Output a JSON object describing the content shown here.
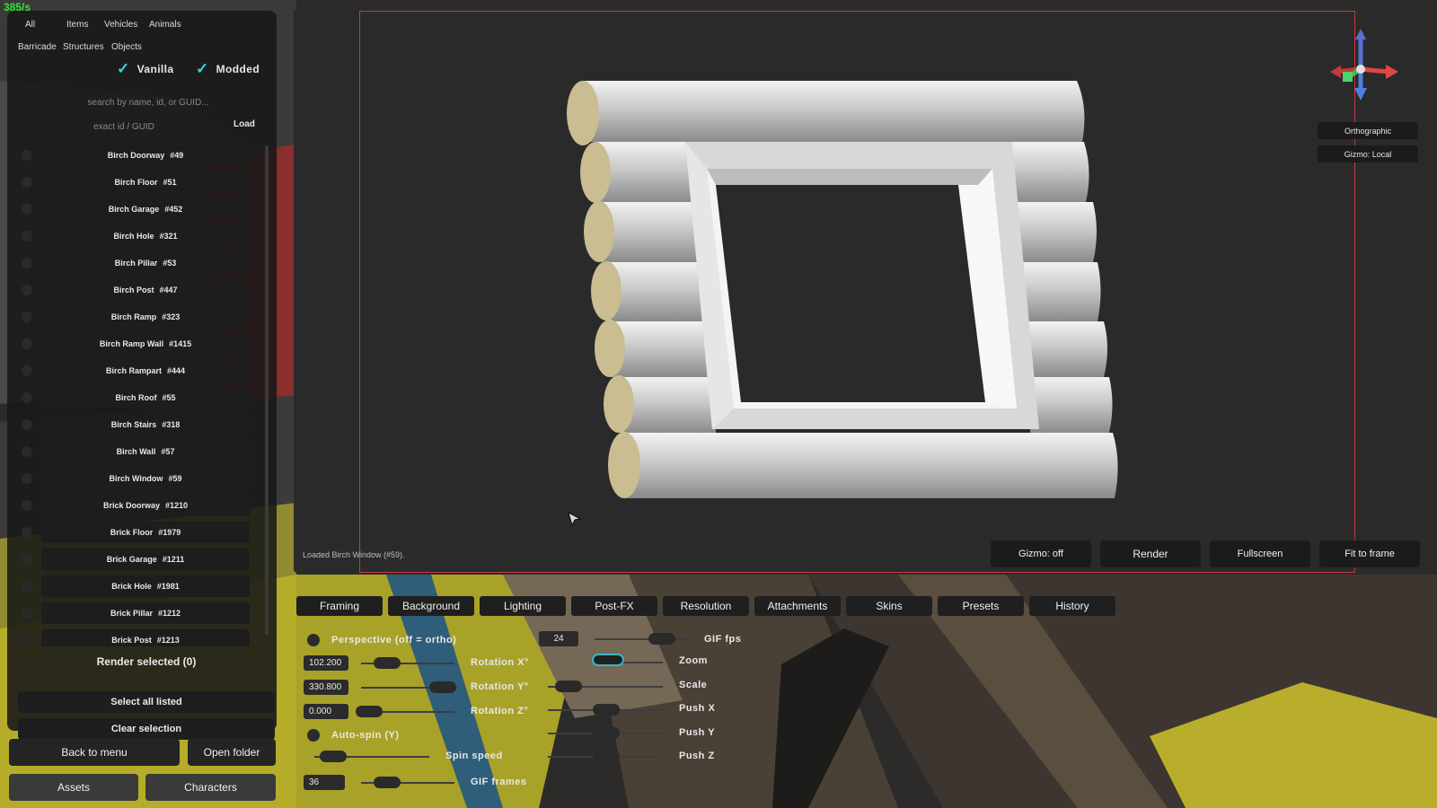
{
  "hud": {
    "fps": "385/s"
  },
  "filters": {
    "row1": [
      "All",
      "Items",
      "Vehicles",
      "Animals"
    ],
    "row2": [
      "Barricade",
      "Structures",
      "Objects"
    ],
    "vanilla": "Vanilla",
    "modded": "Modded",
    "check_icon": "checkmark-icon"
  },
  "search": {
    "placeholder": "search by name, id, or GUID...",
    "value": ""
  },
  "exact": {
    "placeholder": "exact id / GUID",
    "load_label": "Load"
  },
  "assets": [
    {
      "name": "Birch Doorway",
      "id": "#49"
    },
    {
      "name": "Birch Floor",
      "id": "#51"
    },
    {
      "name": "Birch Garage",
      "id": "#452"
    },
    {
      "name": "Birch Hole",
      "id": "#321"
    },
    {
      "name": "Birch Pillar",
      "id": "#53"
    },
    {
      "name": "Birch Post",
      "id": "#447"
    },
    {
      "name": "Birch Ramp",
      "id": "#323"
    },
    {
      "name": "Birch Ramp Wall",
      "id": "#1415"
    },
    {
      "name": "Birch Rampart",
      "id": "#444"
    },
    {
      "name": "Birch Roof",
      "id": "#55"
    },
    {
      "name": "Birch Stairs",
      "id": "#318"
    },
    {
      "name": "Birch Wall",
      "id": "#57"
    },
    {
      "name": "Birch Window",
      "id": "#59"
    },
    {
      "name": "Brick Doorway",
      "id": "#1210"
    },
    {
      "name": "Brick Floor",
      "id": "#1979"
    },
    {
      "name": "Brick Garage",
      "id": "#1211"
    },
    {
      "name": "Brick Hole",
      "id": "#1981"
    },
    {
      "name": "Brick Pillar",
      "id": "#1212"
    },
    {
      "name": "Brick Post",
      "id": "#1213"
    }
  ],
  "actions": {
    "render_selected": "Render selected (0)",
    "select_all": "Select all listed",
    "clear_selection": "Clear selection",
    "back": "Back to menu",
    "open_folder": "Open folder",
    "assets_tab": "Assets",
    "characters_tab": "Characters"
  },
  "viewport": {
    "status": "Loaded Birch Window (#59).",
    "orthographic": "Orthographic",
    "gizmo_local": "Gizmo: Local",
    "gizmo_off": "Gizmo: off",
    "render": "Render",
    "fullscreen": "Fullscreen",
    "fit_to_frame": "Fit to frame",
    "frame_color": "#c8383d",
    "gizmo_icon": "axis-gizmo-icon"
  },
  "tabs": [
    "Framing",
    "Background",
    "Lighting",
    "Post-FX",
    "Resolution",
    "Attachments",
    "Skins",
    "Presets",
    "History"
  ],
  "settings": {
    "perspective_label": "Perspective (off = ortho)",
    "rotation_x": {
      "label": "Rotation X°",
      "value": "102.200"
    },
    "rotation_y": {
      "label": "Rotation Y°",
      "value": "330.800"
    },
    "rotation_z": {
      "label": "Rotation Z°",
      "value": "0.000"
    },
    "auto_spin_label": "Auto-spin (Y)",
    "spin_speed_label": "Spin speed",
    "gif_frames": {
      "label": "GIF frames",
      "value": "36"
    },
    "gif_fps": {
      "label": "GIF fps",
      "value": "24"
    },
    "zoom_label": "Zoom",
    "scale_label": "Scale",
    "push_x_label": "Push X",
    "push_y_label": "Push Y",
    "push_z_label": "Push Z",
    "accent": "#38b6c8"
  }
}
